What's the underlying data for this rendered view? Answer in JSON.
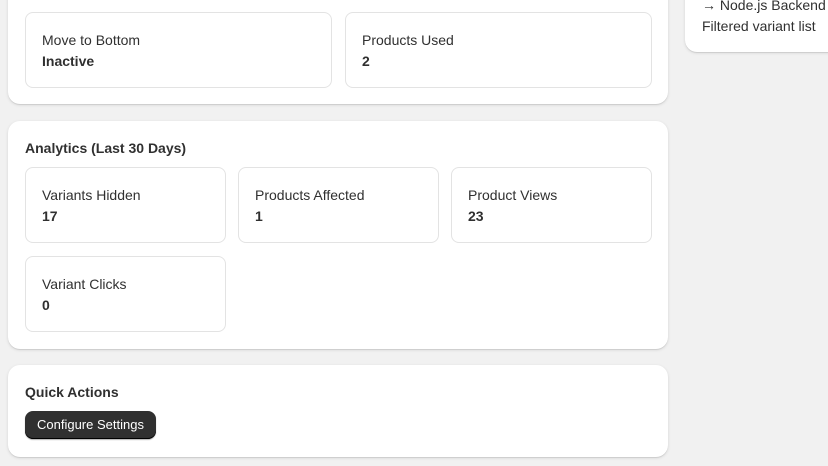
{
  "status_section": {
    "stats": [
      {
        "label": "Move to Bottom",
        "value": "Inactive"
      },
      {
        "label": "Products Used",
        "value": "2"
      }
    ]
  },
  "analytics": {
    "title": "Analytics (Last 30 Days)",
    "stats": [
      {
        "label": "Variants Hidden",
        "value": "17"
      },
      {
        "label": "Products Affected",
        "value": "1"
      },
      {
        "label": "Product Views",
        "value": "23"
      },
      {
        "label": "Variant Clicks",
        "value": "0"
      }
    ]
  },
  "quick_actions": {
    "title": "Quick Actions",
    "configure_button": "Configure Settings"
  },
  "sidebar": {
    "flow_step": "→ Node.js Backend",
    "flow_result": "Filtered variant list"
  }
}
